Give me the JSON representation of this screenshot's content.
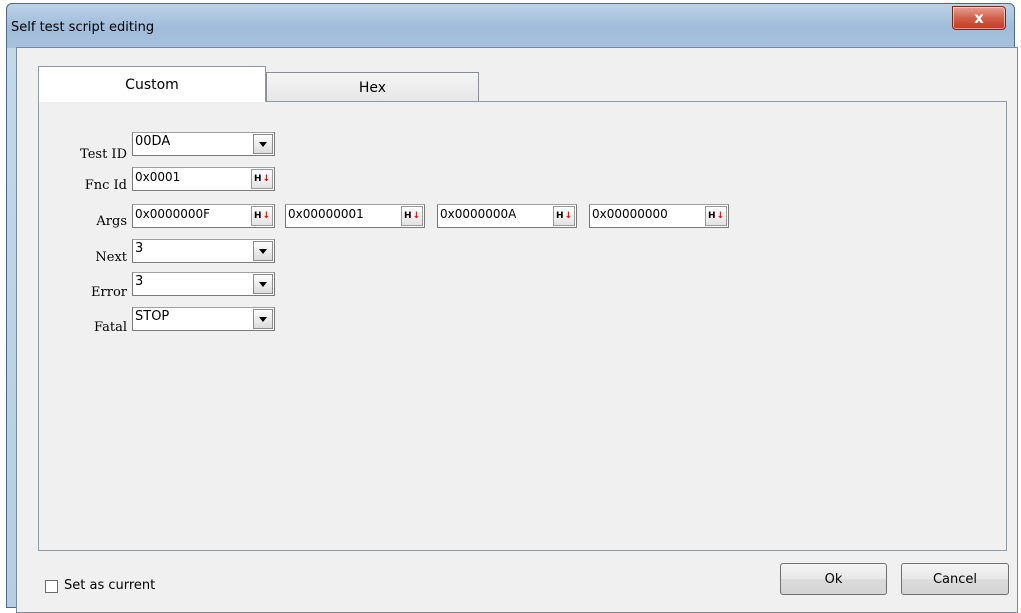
{
  "window": {
    "title": "Self test script editing",
    "close_glyph": "x"
  },
  "tabs": [
    {
      "label": "Custom"
    },
    {
      "label": "Hex"
    }
  ],
  "form": {
    "test_id": {
      "label": "Test ID",
      "value": "00DA"
    },
    "fnc_id": {
      "label": "Fnc Id",
      "value": "0x0001"
    },
    "args": {
      "label": "Args",
      "values": [
        "0x0000000F",
        "0x00000001",
        "0x0000000A",
        "0x00000000"
      ]
    },
    "next": {
      "label": "Next",
      "value": "3"
    },
    "error": {
      "label": "Error",
      "value": "3"
    },
    "fatal": {
      "label": "Fatal",
      "value": "STOP"
    },
    "hex_button": {
      "h": "H",
      "arrow": "↓"
    }
  },
  "footer": {
    "set_as_current": {
      "label": "Set as current",
      "checked": false
    },
    "ok_label": "Ok",
    "cancel_label": "Cancel"
  },
  "icons": {
    "dropdown": "chevron-down-icon",
    "hex_toggle": "hex-down-arrow-icon",
    "close": "close-icon"
  },
  "colors": {
    "close_button": "#c3381f",
    "hex_arrow": "#cc1111"
  }
}
